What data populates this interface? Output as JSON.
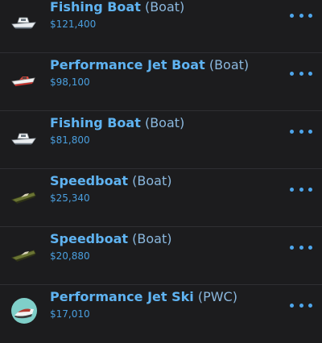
{
  "vehicles": [
    {
      "name": "Fishing Boat",
      "type": "(Boat)",
      "price": "$121,400",
      "icon": "fishing-boat-icon"
    },
    {
      "name": "Performance Jet Boat",
      "type": "(Boat)",
      "price": "$98,100",
      "icon": "jet-boat-icon"
    },
    {
      "name": "Fishing Boat",
      "type": "(Boat)",
      "price": "$81,800",
      "icon": "fishing-boat-icon"
    },
    {
      "name": "Speedboat",
      "type": "(Boat)",
      "price": "$25,340",
      "icon": "speedboat-icon"
    },
    {
      "name": "Speedboat",
      "type": "(Boat)",
      "price": "$20,880",
      "icon": "speedboat-icon"
    },
    {
      "name": "Performance Jet Ski",
      "type": "(PWC)",
      "price": "$17,010",
      "icon": "jet-ski-icon"
    }
  ],
  "colors": {
    "background": "#1c1c1e",
    "name": "#5fb3f1",
    "type": "#8bb8de",
    "price": "#4a9fdf",
    "menu_dots": "#4ea6ec"
  }
}
